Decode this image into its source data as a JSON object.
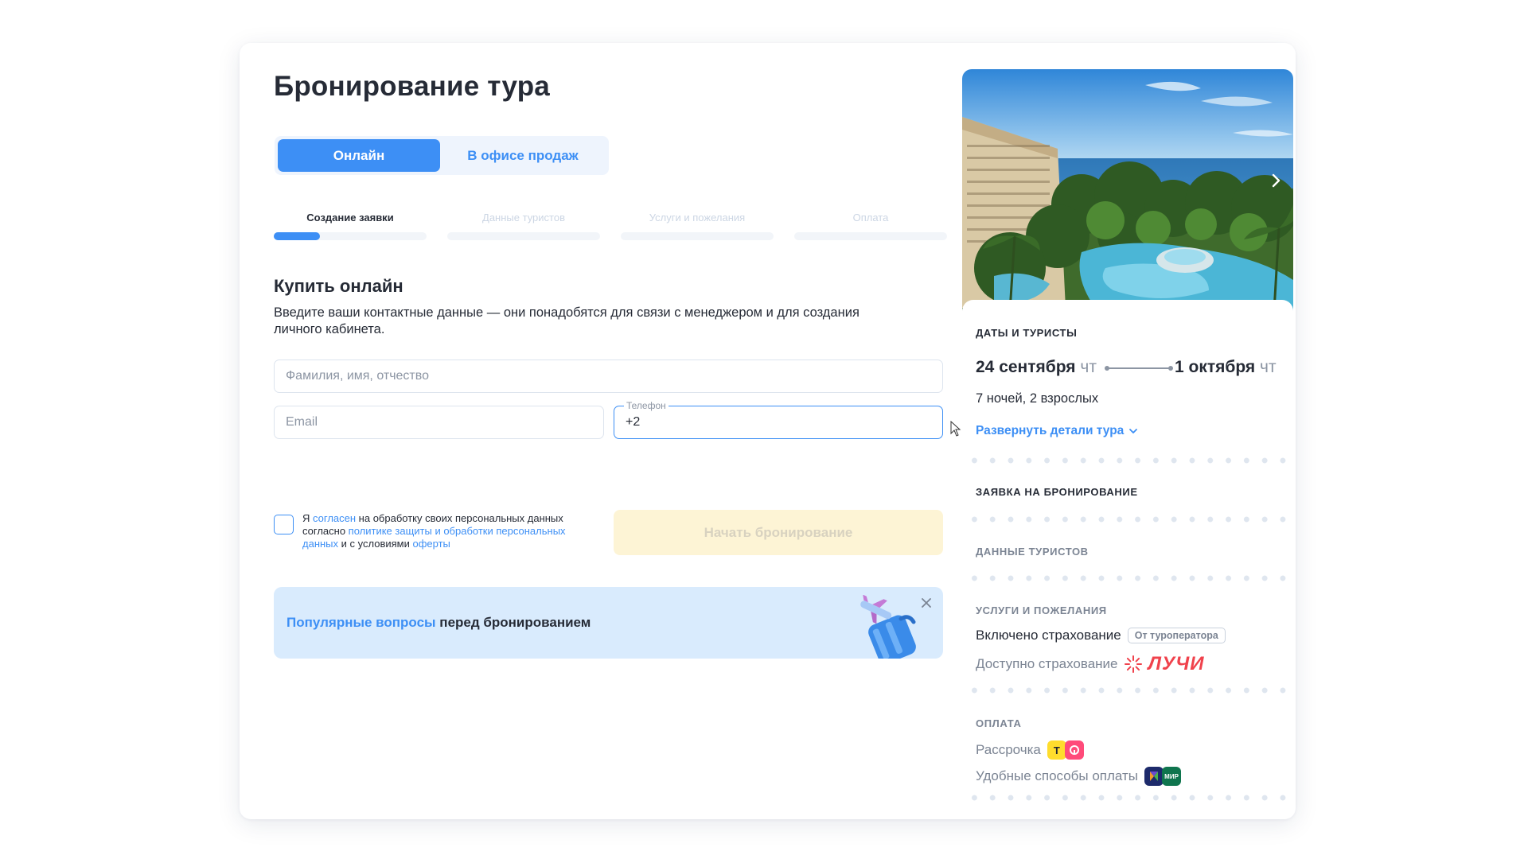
{
  "page": {
    "title": "Бронирование тура"
  },
  "mode": {
    "online_label": "Онлайн",
    "office_label": "В офисе продаж"
  },
  "steps": [
    {
      "label": "Создание заявки",
      "progress": 0.3
    },
    {
      "label": "Данные туристов",
      "progress": 0
    },
    {
      "label": "Услуги и пожелания",
      "progress": 0
    },
    {
      "label": "Оплата",
      "progress": 0
    }
  ],
  "form": {
    "title": "Купить онлайн",
    "description": "Введите ваши контактные данные — они понадобятся для связи с менеджером и для создания личного кабинета.",
    "fullname_placeholder": "Фамилия, имя, отчество",
    "email_placeholder": "Email",
    "phone_label": "Телефон",
    "phone_value": "+2",
    "consent": {
      "p1": "Я ",
      "link_agree": "согласен",
      "p2": " на обработку своих персональных данных согласно ",
      "link_policy": "политике защиты и обработки персональных данных",
      "p3": " и с условиями ",
      "link_offer": "оферты"
    },
    "submit_label": "Начать бронирование"
  },
  "faq": {
    "link_text": "Популярные вопросы",
    "rest_text": " перед бронированием"
  },
  "summary": {
    "dates_heading": "Даты и туристы",
    "date_from": "24 сентября",
    "date_from_dow": "чт",
    "date_to": "1 октября",
    "date_to_dow": "чт",
    "nights_guests": "7 ночей, 2 взрослых",
    "expand_link": "Развернуть детали тура",
    "booking_heading": "Заявка на бронирование",
    "tourists_heading": "Данные туристов",
    "services_heading": "Услуги и пожелания",
    "insurance_included": "Включено страхование",
    "insurance_tag": "От туроператора",
    "insurance_available": "Доступно страхование",
    "insurance_brand": "ЛУЧИ",
    "payment_heading": "Оплата",
    "installments": "Рассрочка",
    "payment_methods": "Удобные способы оплаты",
    "badge_t": "Т",
    "badge_mir": "МИР"
  },
  "colors": {
    "accent": "#3d8ff5",
    "cta_disabled_bg": "#fdf4d5",
    "faq_bg": "#d9ebfd",
    "brand_red": "#f0424c"
  }
}
